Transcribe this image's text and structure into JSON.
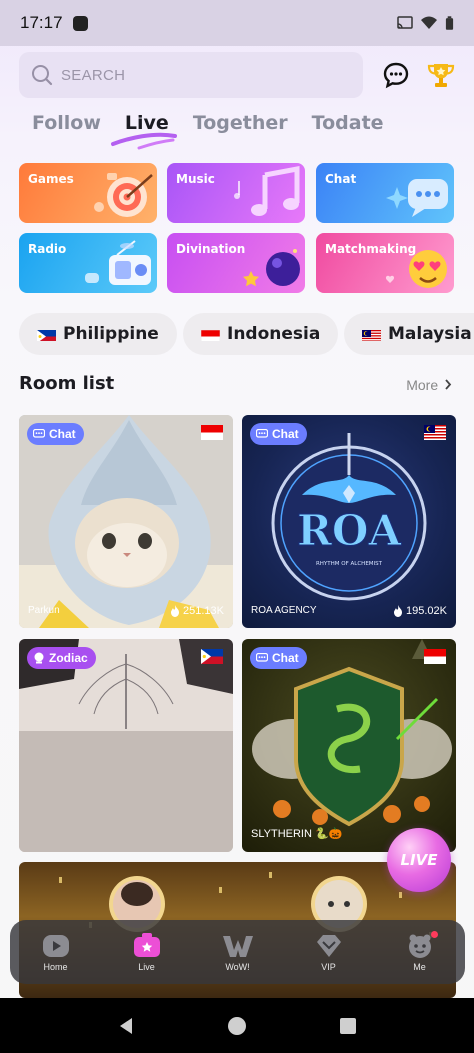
{
  "status_bar": {
    "time": "17:17"
  },
  "search": {
    "placeholder": "SEARCH"
  },
  "tabs": [
    {
      "label": "Follow"
    },
    {
      "label": "Live"
    },
    {
      "label": "Together"
    },
    {
      "label": "Todate"
    }
  ],
  "active_tab": "Live",
  "categories": [
    {
      "label": "Games",
      "color": "#ff8a3d"
    },
    {
      "label": "Music",
      "color": "#b45cf2"
    },
    {
      "label": "Chat",
      "color": "#3d8ef5"
    },
    {
      "label": "Radio",
      "color": "#1fa9f2"
    },
    {
      "label": "Divination",
      "color": "#d24ff2"
    },
    {
      "label": "Matchmaking",
      "color": "#f55aa6"
    }
  ],
  "countries": [
    {
      "label": "Philippine"
    },
    {
      "label": "Indonesia"
    },
    {
      "label": "Malaysia"
    }
  ],
  "room_list": {
    "title": "Room list",
    "more": "More"
  },
  "rooms": [
    {
      "tag": "Chat",
      "name": "Parkun",
      "count": "251.13K",
      "flag": "indonesia"
    },
    {
      "tag": "Chat",
      "name": "ROA AGENCY",
      "count": "195.02K",
      "flag": "malaysia",
      "logo_text": "ROA",
      "logo_sub": "RHYTHM OF ALCHEMIST"
    },
    {
      "tag": "Zodiac",
      "name": "",
      "count": "",
      "flag": "philippine"
    },
    {
      "tag": "Chat",
      "name": "SLYTHERIN 🐍🎃",
      "count": "",
      "flag": "indonesia"
    }
  ],
  "live_button": {
    "label": "LIVE"
  },
  "bottom_nav": [
    {
      "label": "Home"
    },
    {
      "label": "Live"
    },
    {
      "label": "WoW!"
    },
    {
      "label": "VIP"
    },
    {
      "label": "Me"
    }
  ]
}
